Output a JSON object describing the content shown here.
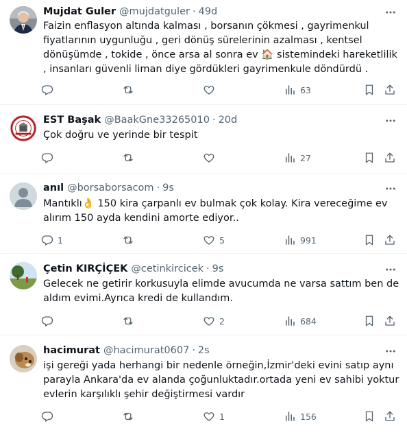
{
  "tweets": [
    {
      "name": "Mujdat Guler",
      "handle": "@mujdatguler",
      "time": "49d",
      "text": "Faizin enflasyon altında kalması , borsanın çökmesi , gayrimenkul fiyatlarının uygunluğu , geri dönüş sürelerinin azalması , kentsel dönüşümde , tokide , önce arsa al sonra ev 🏠 sistemindeki hareketlilik , insanları güvenli liman diye gördükleri gayrimenkule döndürdü .",
      "replies": "",
      "retweets": "",
      "likes": "",
      "views": "63"
    },
    {
      "name": "EST Başak",
      "handle": "@BaakGne33265010",
      "time": "20d",
      "text": "Çok doğru ve yerinde bir tespit",
      "replies": "",
      "retweets": "",
      "likes": "",
      "views": "27"
    },
    {
      "name": "anıl",
      "handle": "@borsaborsacom",
      "time": "9s",
      "text": "Mantıklı👌 150 kira çarpanlı ev bulmak çok kolay. Kira vereceğime ev alırım 150 ayda kendini amorte ediyor..",
      "replies": "1",
      "retweets": "",
      "likes": "5",
      "views": "991"
    },
    {
      "name": "Çetin KIRÇİÇEK",
      "handle": "@cetinkircicek",
      "time": "9s",
      "text": "Gelecek ne getirir korkusuyla elimde avucumda ne varsa sattım ben de aldım evimi.Ayrıca kredi de kullandım.",
      "replies": "",
      "retweets": "",
      "likes": "2",
      "views": "684"
    },
    {
      "name": "hacimurat",
      "handle": "@hacimurat0607",
      "time": "2s",
      "text": "işi gereği yada herhangi bir nedenle örneğin,İzmir'deki evini satıp aynı parayla Ankara'da ev alanda çoğunluktadır.ortada yeni ev sahibi yoktur evlerin karşılıklı şehir değiştirmesi vardır",
      "replies": "",
      "retweets": "",
      "likes": "1",
      "views": "156"
    }
  ],
  "separator": "·",
  "icons": {
    "reply": "reply-icon",
    "retweet": "retweet-icon",
    "like": "heart-icon",
    "views": "views-icon",
    "bookmark": "bookmark-icon",
    "share": "share-icon",
    "more": "more-icon"
  },
  "colors": {
    "text": "#0f1419",
    "secondary": "#536471",
    "divider": "#eff3f4"
  }
}
